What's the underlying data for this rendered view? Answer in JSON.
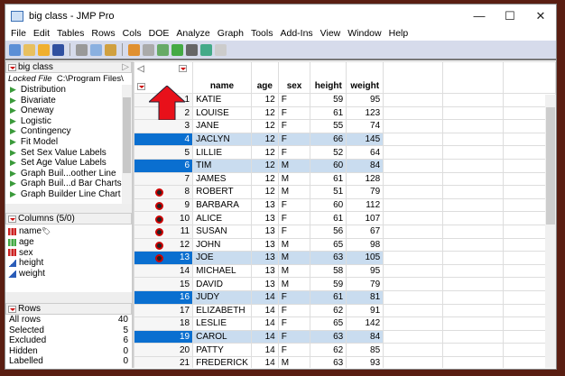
{
  "window": {
    "title": "big class - JMP Pro",
    "controls": [
      "—",
      "☐",
      "✕"
    ]
  },
  "menu": [
    "File",
    "Edit",
    "Tables",
    "Rows",
    "Cols",
    "DOE",
    "Analyze",
    "Graph",
    "Tools",
    "Add-Ins",
    "View",
    "Window",
    "Help"
  ],
  "left": {
    "table_name": "big class",
    "locked_label": "Locked File",
    "locked_path": "C:\\Program Files\\",
    "scripts": [
      "Distribution",
      "Bivariate",
      "Oneway",
      "Logistic",
      "Contingency",
      "Fit Model",
      "Set Sex Value Labels",
      "Set Age Value Labels",
      "Graph Buil...oother Line",
      "Graph Buil...d Bar Charts",
      "Graph Builder Line Chart"
    ],
    "columns_header": "Columns (5/0)",
    "columns": [
      {
        "name": "name",
        "type": "nominal"
      },
      {
        "name": "age",
        "type": "ordinal"
      },
      {
        "name": "sex",
        "type": "nominal"
      },
      {
        "name": "height",
        "type": "continuous"
      },
      {
        "name": "weight",
        "type": "continuous"
      }
    ],
    "rows_header": "Rows",
    "rows_info": [
      {
        "label": "All rows",
        "value": "40"
      },
      {
        "label": "Selected",
        "value": "5"
      },
      {
        "label": "Excluded",
        "value": "6"
      },
      {
        "label": "Hidden",
        "value": "0"
      },
      {
        "label": "Labelled",
        "value": "0"
      }
    ]
  },
  "grid": {
    "headers": [
      "name",
      "age",
      "sex",
      "height",
      "weight"
    ],
    "rows": [
      {
        "n": "1",
        "name": "KATIE",
        "age": "12",
        "sex": "F",
        "height": "59",
        "weight": "95",
        "sel": false,
        "ex": false
      },
      {
        "n": "2",
        "name": "LOUISE",
        "age": "12",
        "sex": "F",
        "height": "61",
        "weight": "123",
        "sel": false,
        "ex": false
      },
      {
        "n": "3",
        "name": "JANE",
        "age": "12",
        "sex": "F",
        "height": "55",
        "weight": "74",
        "sel": false,
        "ex": false
      },
      {
        "n": "4",
        "name": "JACLYN",
        "age": "12",
        "sex": "F",
        "height": "66",
        "weight": "145",
        "sel": true,
        "ex": false
      },
      {
        "n": "5",
        "name": "LILLIE",
        "age": "12",
        "sex": "F",
        "height": "52",
        "weight": "64",
        "sel": false,
        "ex": false
      },
      {
        "n": "6",
        "name": "TIM",
        "age": "12",
        "sex": "M",
        "height": "60",
        "weight": "84",
        "sel": true,
        "ex": false
      },
      {
        "n": "7",
        "name": "JAMES",
        "age": "12",
        "sex": "M",
        "height": "61",
        "weight": "128",
        "sel": false,
        "ex": false
      },
      {
        "n": "8",
        "name": "ROBERT",
        "age": "12",
        "sex": "M",
        "height": "51",
        "weight": "79",
        "sel": false,
        "ex": true
      },
      {
        "n": "9",
        "name": "BARBARA",
        "age": "13",
        "sex": "F",
        "height": "60",
        "weight": "112",
        "sel": false,
        "ex": true
      },
      {
        "n": "10",
        "name": "ALICE",
        "age": "13",
        "sex": "F",
        "height": "61",
        "weight": "107",
        "sel": false,
        "ex": true
      },
      {
        "n": "11",
        "name": "SUSAN",
        "age": "13",
        "sex": "F",
        "height": "56",
        "weight": "67",
        "sel": false,
        "ex": true
      },
      {
        "n": "12",
        "name": "JOHN",
        "age": "13",
        "sex": "M",
        "height": "65",
        "weight": "98",
        "sel": false,
        "ex": true
      },
      {
        "n": "13",
        "name": "JOE",
        "age": "13",
        "sex": "M",
        "height": "63",
        "weight": "105",
        "sel": true,
        "ex": true
      },
      {
        "n": "14",
        "name": "MICHAEL",
        "age": "13",
        "sex": "M",
        "height": "58",
        "weight": "95",
        "sel": false,
        "ex": false
      },
      {
        "n": "15",
        "name": "DAVID",
        "age": "13",
        "sex": "M",
        "height": "59",
        "weight": "79",
        "sel": false,
        "ex": false
      },
      {
        "n": "16",
        "name": "JUDY",
        "age": "14",
        "sex": "F",
        "height": "61",
        "weight": "81",
        "sel": true,
        "ex": false
      },
      {
        "n": "17",
        "name": "ELIZABETH",
        "age": "14",
        "sex": "F",
        "height": "62",
        "weight": "91",
        "sel": false,
        "ex": false
      },
      {
        "n": "18",
        "name": "LESLIE",
        "age": "14",
        "sex": "F",
        "height": "65",
        "weight": "142",
        "sel": false,
        "ex": false
      },
      {
        "n": "19",
        "name": "CAROL",
        "age": "14",
        "sex": "F",
        "height": "63",
        "weight": "84",
        "sel": true,
        "ex": false
      },
      {
        "n": "20",
        "name": "PATTY",
        "age": "14",
        "sex": "F",
        "height": "62",
        "weight": "85",
        "sel": false,
        "ex": false
      },
      {
        "n": "21",
        "name": "FREDERICK",
        "age": "14",
        "sex": "M",
        "height": "63",
        "weight": "93",
        "sel": false,
        "ex": false
      }
    ]
  },
  "colors": {
    "selected": "#0a6fd0",
    "selected_row": "#c9dcef",
    "arrow": "#e8101a",
    "toolbar": "#d6dbeb"
  }
}
